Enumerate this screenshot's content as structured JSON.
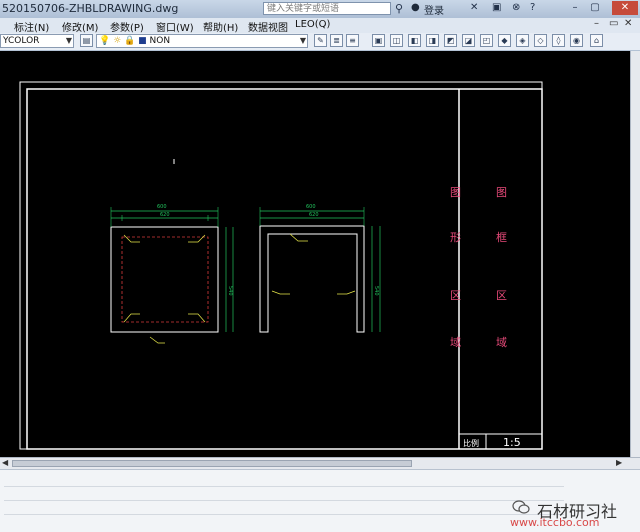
{
  "window": {
    "title": "520150706-ZHBLDRAWING.dwg",
    "search_placeholder": "键入关键字或短语",
    "login_label": "登录",
    "colors": {
      "titlebar": "#b7c7dc",
      "canvas": "#000000",
      "frame": "#ffffff",
      "dims": "#22c55e",
      "label_text": "#e84a7a",
      "leader": "#e8e84a"
    }
  },
  "menu": {
    "items": [
      "标注(N)",
      "修改(M)",
      "参数(P)",
      "窗口(W)",
      "帮助(H)",
      "数据视图",
      "LEO(Q)"
    ]
  },
  "toolbar": {
    "color_combo": "YCOLOR",
    "layer_combo": "NON"
  },
  "drawing": {
    "zone_labels": {
      "left_column": [
        "图",
        "形",
        "区",
        "域"
      ],
      "right_column": [
        "图",
        "框",
        "区",
        "域"
      ]
    },
    "title_block": {
      "label": "比例",
      "scale": "1:5"
    },
    "views": [
      {
        "name": "front-view",
        "dims": [
          "600",
          "620",
          "540"
        ]
      },
      {
        "name": "side-view",
        "dims": [
          "600",
          "620",
          "540"
        ]
      }
    ]
  },
  "watermark": {
    "icon": "wechat-icon",
    "text": "石材研习社",
    "url": "www.itccbo.com"
  }
}
